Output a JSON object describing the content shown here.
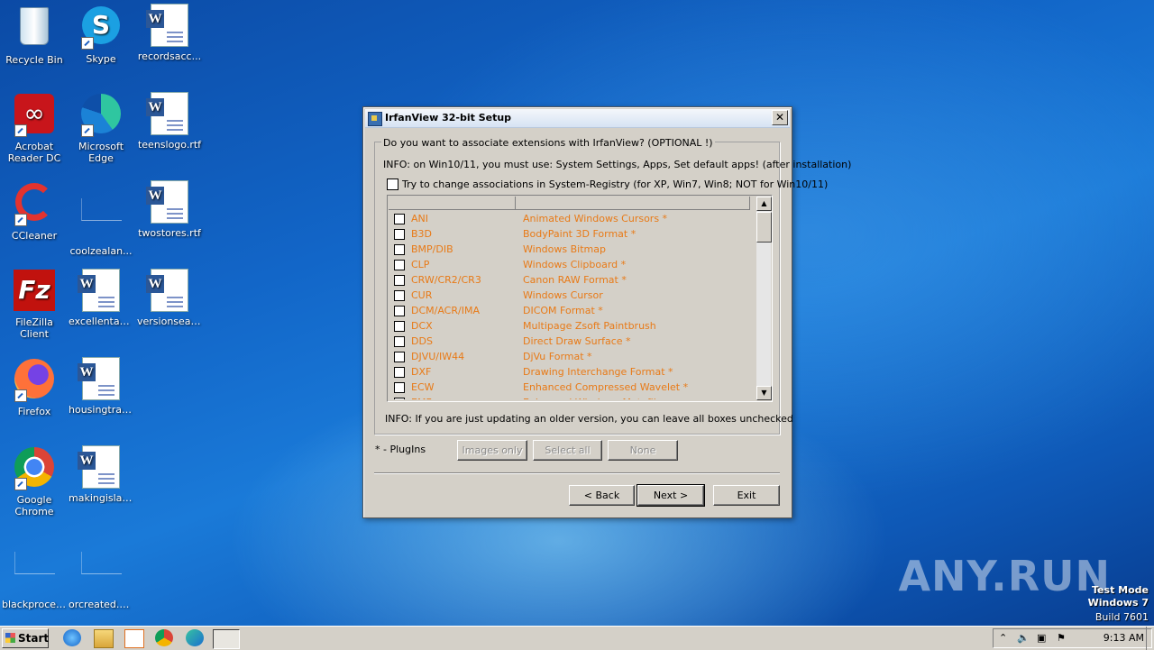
{
  "desktop": {
    "icons": [
      {
        "label": "Recycle Bin",
        "icon": "recycle-bin-icon"
      },
      {
        "label": "Skype",
        "icon": "skype-icon"
      },
      {
        "label": "recordsacc...",
        "icon": "word-document-icon"
      },
      {
        "label": "Acrobat Reader DC",
        "icon": "acrobat-icon"
      },
      {
        "label": "Microsoft Edge",
        "icon": "edge-icon"
      },
      {
        "label": "teenslogo.rtf",
        "icon": "word-document-icon"
      },
      {
        "label": "CCleaner",
        "icon": "ccleaner-icon"
      },
      {
        "label": "coolzealan...",
        "icon": "blank-file-icon"
      },
      {
        "label": "twostores.rtf",
        "icon": "word-document-icon"
      },
      {
        "label": "FileZilla Client",
        "icon": "filezilla-icon"
      },
      {
        "label": "excellentag...",
        "icon": "word-document-icon"
      },
      {
        "label": "versionsear...",
        "icon": "word-document-icon"
      },
      {
        "label": "Firefox",
        "icon": "firefox-icon"
      },
      {
        "label": "housingtradi...",
        "icon": "word-document-icon"
      },
      {
        "label": "Google Chrome",
        "icon": "chrome-icon"
      },
      {
        "label": "makingislan...",
        "icon": "word-document-icon"
      },
      {
        "label": "blackproces...",
        "icon": "blank-file-icon"
      },
      {
        "label": "orcreated.png",
        "icon": "blank-file-icon"
      }
    ]
  },
  "dialog": {
    "title": "IrfanView 32-bit Setup",
    "close_label": "✕",
    "group_title": "Do you want to associate extensions with IrfanView? (OPTIONAL !)",
    "info_top": "INFO: on Win10/11, you must use: System Settings, Apps, Set default apps! (after installation)",
    "registry_checkbox_label": "Try to change associations in System-Registry (for XP, Win7, Win8; NOT for Win10/11)",
    "extensions": [
      {
        "ext": "ANI",
        "desc": "Animated Windows Cursors *"
      },
      {
        "ext": "B3D",
        "desc": "BodyPaint 3D Format *"
      },
      {
        "ext": "BMP/DIB",
        "desc": "Windows Bitmap"
      },
      {
        "ext": "CLP",
        "desc": "Windows Clipboard *"
      },
      {
        "ext": "CRW/CR2/CR3",
        "desc": "Canon RAW Format *"
      },
      {
        "ext": "CUR",
        "desc": "Windows Cursor"
      },
      {
        "ext": "DCM/ACR/IMA",
        "desc": "DICOM Format *"
      },
      {
        "ext": "DCX",
        "desc": "Multipage Zsoft Paintbrush"
      },
      {
        "ext": "DDS",
        "desc": "Direct Draw Surface *"
      },
      {
        "ext": "DJVU/IW44",
        "desc": "DjVu Format *"
      },
      {
        "ext": "DXF",
        "desc": "Drawing Interchange Format *"
      },
      {
        "ext": "ECW",
        "desc": "Enhanced Compressed Wavelet *"
      },
      {
        "ext": "EMF",
        "desc": "Enhanced Windows Metafile"
      }
    ],
    "info_bottom": "INFO: If you are just updating an older version, you can leave all boxes unchecked",
    "plugins_note": "* - PlugIns",
    "images_only_label": "Images only",
    "select_all_label": "Select all",
    "none_label": "None",
    "back_label": "< Back",
    "next_label": "Next >",
    "exit_label": "Exit"
  },
  "watermark": "ANY.RUN",
  "windows_info": {
    "line1": "Test Mode",
    "line2": "Windows 7",
    "line3": "Build 7601"
  },
  "taskbar": {
    "start_label": "Start",
    "clock": "9:13 AM"
  }
}
